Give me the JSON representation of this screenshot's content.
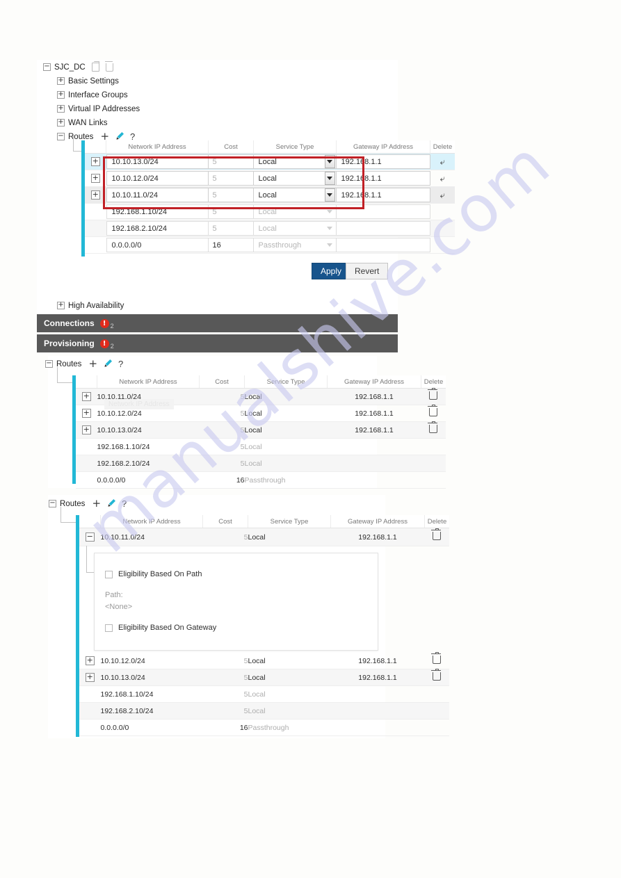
{
  "watermark": {
    "text": "manualshive.com"
  },
  "tree": {
    "root": {
      "label": "SJC_DC",
      "toggle": "−",
      "copy_icon": "copy-icon",
      "delete_icon": "trash-icon"
    },
    "items": [
      {
        "label": "Basic Settings",
        "toggle": "+"
      },
      {
        "label": "Interface Groups",
        "toggle": "+"
      },
      {
        "label": "Virtual IP Addresses",
        "toggle": "+"
      },
      {
        "label": "WAN Links",
        "toggle": "+"
      },
      {
        "label": "Routes",
        "toggle": "−"
      }
    ],
    "high_availability": {
      "label": "High Availability",
      "toggle": "+"
    }
  },
  "routes_toolbar": {
    "add": "+",
    "edit": "pencil-icon",
    "help": "?"
  },
  "table": {
    "headers": [
      "Network IP Address",
      "Cost",
      "Service Type",
      "Gateway IP Address",
      "Delete"
    ]
  },
  "section1": {
    "title": "Routes",
    "rows": [
      {
        "expand": "+",
        "network": "10.10.13.0/24",
        "cost": "5",
        "service": "Local",
        "gateway": "192.168.1.1",
        "editable": true,
        "action": "undo",
        "highlight": "blue"
      },
      {
        "expand": "+",
        "network": "10.10.12.0/24",
        "cost": "5",
        "service": "Local",
        "gateway": "192.168.1.1",
        "editable": true,
        "action": "undo",
        "highlight": "none"
      },
      {
        "expand": "+",
        "network": "10.10.11.0/24",
        "cost": "5",
        "service": "Local",
        "gateway": "192.168.1.1",
        "editable": true,
        "action": "undo",
        "highlight": "gray"
      },
      {
        "expand": "",
        "network": "192.168.1.10/24",
        "cost": "5",
        "service": "Local",
        "gateway": "",
        "editable": false,
        "action": "",
        "highlight": "none"
      },
      {
        "expand": "",
        "network": "192.168.2.10/24",
        "cost": "5",
        "service": "Local",
        "gateway": "",
        "editable": false,
        "action": "",
        "highlight": "gray"
      },
      {
        "expand": "",
        "network": "0.0.0.0/0",
        "cost": "16",
        "service": "Passthrough",
        "gateway": "",
        "editable": false,
        "action": "",
        "highlight": "none"
      }
    ],
    "apply_label": "Apply",
    "revert_label": "Revert"
  },
  "bars": [
    {
      "label": "Connections",
      "badge": "!",
      "count": "2"
    },
    {
      "label": "Provisioning",
      "badge": "!",
      "count": "2"
    }
  ],
  "section2": {
    "title": "Routes",
    "ghost_text": "Network IP Address",
    "rows": [
      {
        "expand": "+",
        "network": "10.10.11.0/24",
        "cost": "5",
        "service": "Local",
        "gateway": "192.168.1.1",
        "delete": true,
        "alt": true
      },
      {
        "expand": "+",
        "network": "10.10.12.0/24",
        "cost": "5",
        "service": "Local",
        "gateway": "192.168.1.1",
        "delete": true,
        "alt": false
      },
      {
        "expand": "+",
        "network": "10.10.13.0/24",
        "cost": "5",
        "service": "Local",
        "gateway": "192.168.1.1",
        "delete": true,
        "alt": true
      },
      {
        "expand": "",
        "network": "192.168.1.10/24",
        "cost": "5",
        "service": "Local",
        "gateway": "",
        "delete": false,
        "alt": false
      },
      {
        "expand": "",
        "network": "192.168.2.10/24",
        "cost": "5",
        "service": "Local",
        "gateway": "",
        "delete": false,
        "alt": true
      },
      {
        "expand": "",
        "network": "0.0.0.0/0",
        "cost": "16",
        "service": "Passthrough",
        "gateway": "",
        "delete": false,
        "alt": false
      }
    ]
  },
  "section3": {
    "title": "Routes",
    "expanded_row": {
      "expand": "−",
      "network": "10.10.11.0/24",
      "cost": "5",
      "service": "Local",
      "gateway": "192.168.1.1",
      "delete": true
    },
    "detail": {
      "path_checkbox_label": "Eligibility Based On Path",
      "path_label": "Path:",
      "path_value": "<None>",
      "gateway_checkbox_label": "Eligibility Based On Gateway"
    },
    "rows": [
      {
        "expand": "+",
        "network": "10.10.12.0/24",
        "cost": "5",
        "service": "Local",
        "gateway": "192.168.1.1",
        "delete": true,
        "alt": false
      },
      {
        "expand": "+",
        "network": "10.10.13.0/24",
        "cost": "5",
        "service": "Local",
        "gateway": "192.168.1.1",
        "delete": true,
        "alt": true
      },
      {
        "expand": "",
        "network": "192.168.1.10/24",
        "cost": "5",
        "service": "Local",
        "gateway": "",
        "delete": false,
        "alt": false
      },
      {
        "expand": "",
        "network": "192.168.2.10/24",
        "cost": "5",
        "service": "Local",
        "gateway": "",
        "delete": false,
        "alt": true
      },
      {
        "expand": "",
        "network": "0.0.0.0/0",
        "cost": "16",
        "service": "Passthrough",
        "gateway": "",
        "delete": false,
        "alt": false
      }
    ]
  },
  "colors": {
    "accent_teal": "#22b8d6",
    "highlight_box": "#c12026",
    "apply_blue": "#17548c",
    "bar_gray": "#585858",
    "error_red": "#e02b1d"
  }
}
